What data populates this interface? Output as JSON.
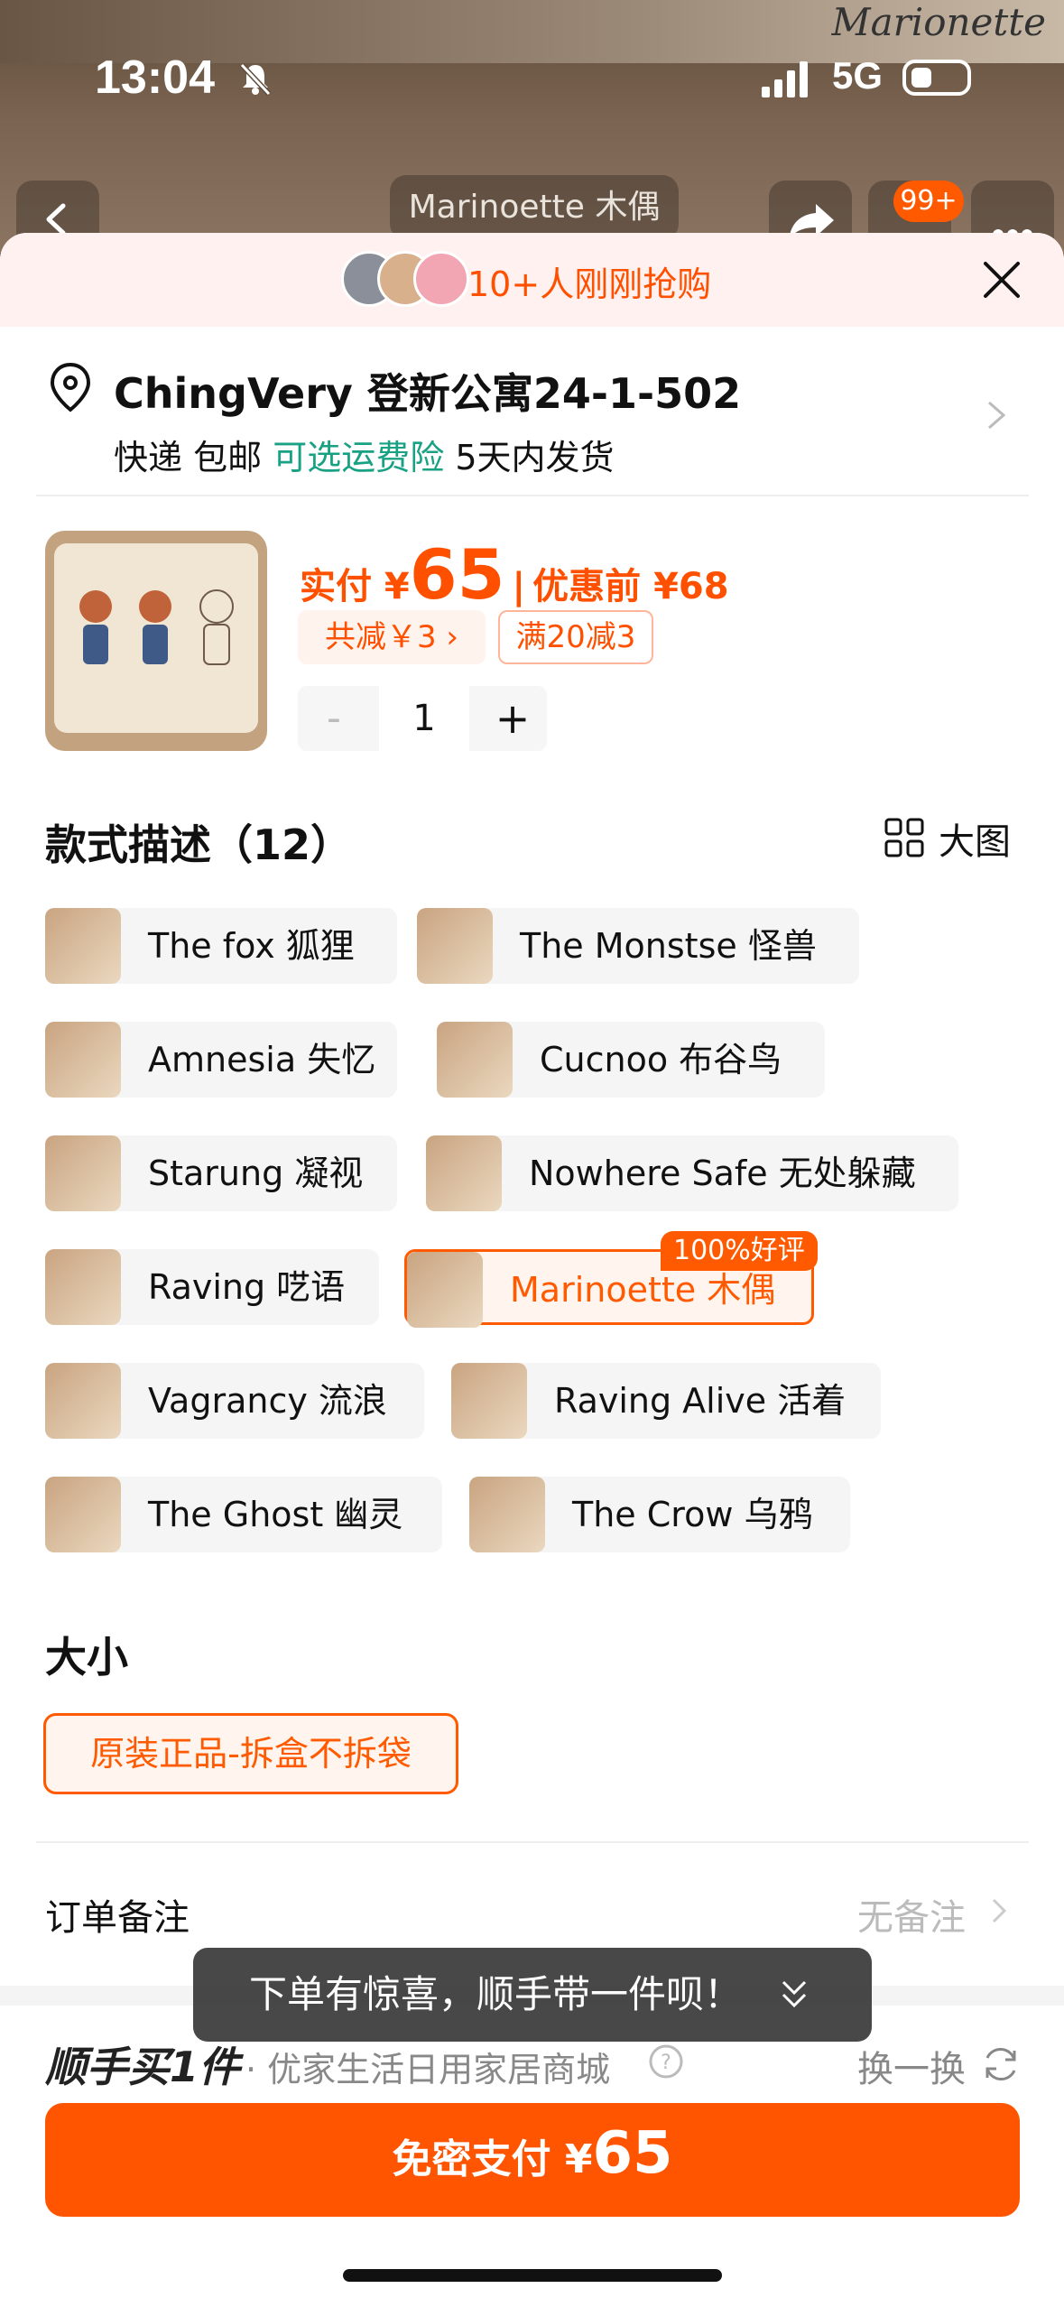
{
  "status_bar": {
    "time": "13:04",
    "network": "5G"
  },
  "brand_text": "Marionette",
  "nav": {
    "title": "Marinoette 木偶",
    "cart_badge": "99+"
  },
  "promo": {
    "text": "10+人刚刚抢购"
  },
  "address": {
    "line": "ChingVery 登新公寓24-1-502",
    "ship_method": "快递",
    "ship_free": "包邮",
    "ship_insurance": "可选运费险",
    "ship_time": "5天内发货"
  },
  "price": {
    "paid_label": "实付 ¥",
    "paid_amount": "65",
    "sep": "|",
    "before_label": "优惠前 ¥68",
    "discount_chip": "共减￥3 ›",
    "full_reduce_chip": "满20减3"
  },
  "quantity": {
    "minus": "-",
    "value": "1",
    "plus": "+"
  },
  "style_section": {
    "title": "款式描述（12）",
    "big_view": "大图",
    "options": [
      {
        "label": "The fox 狐狸"
      },
      {
        "label": "The Monstse 怪兽"
      },
      {
        "label": "Amnesia 失忆"
      },
      {
        "label": "Cucnoo 布谷鸟"
      },
      {
        "label": "Starung 凝视"
      },
      {
        "label": "Nowhere Safe 无处躲藏"
      },
      {
        "label": "Raving 呓语"
      },
      {
        "label": "Marinoette 木偶"
      },
      {
        "label": "Vagrancy 流浪"
      },
      {
        "label": "Raving Alive 活着"
      },
      {
        "label": "The Ghost 幽灵"
      },
      {
        "label": "The Crow 乌鸦"
      }
    ],
    "selected_badge": "100%好评"
  },
  "size_section": {
    "title": "大小",
    "option": "原装正品-拆盒不拆袋"
  },
  "note": {
    "label": "订单备注",
    "value": "无备注"
  },
  "toast": {
    "prefix": "下单有惊喜，",
    "highlight": "顺手带一件呗！"
  },
  "addon": {
    "title": "顺手买1件",
    "subtitle": "· 优家生活日用家居商城",
    "swap": "换一换"
  },
  "pay": {
    "label": "免密支付 ¥",
    "amount": "65"
  },
  "colors": {
    "accent": "#ff5500",
    "green": "#18a183"
  }
}
